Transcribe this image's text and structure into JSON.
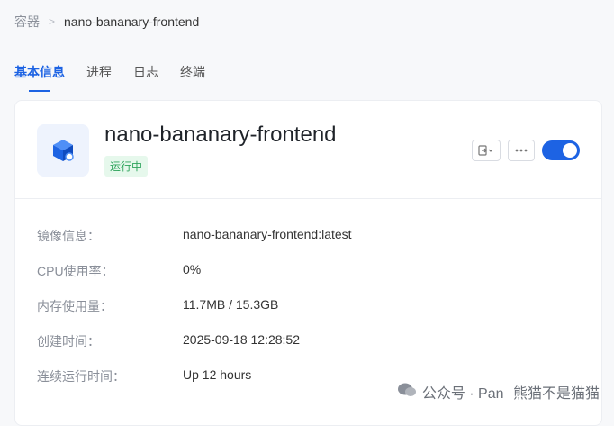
{
  "breadcrumb": {
    "root": "容器",
    "separator": ">",
    "current": "nano-bananary-frontend"
  },
  "tabs": [
    {
      "label": "基本信息",
      "active": true
    },
    {
      "label": "进程",
      "active": false
    },
    {
      "label": "日志",
      "active": false
    },
    {
      "label": "终端",
      "active": false
    }
  ],
  "container": {
    "name": "nano-bananary-frontend",
    "status": "运行中",
    "icon": "container-cube-icon",
    "running": true
  },
  "actions": {
    "login_icon": "login-icon",
    "more_icon": "more-icon"
  },
  "info": [
    {
      "label": "镜像信息：",
      "value": "nano-bananary-frontend:latest"
    },
    {
      "label": "CPU使用率：",
      "value": "0%"
    },
    {
      "label": "内存使用量：",
      "value": "11.7MB / 15.3GB"
    },
    {
      "label": "创建时间：",
      "value": "2025-09-18 12:28:52"
    },
    {
      "label": "连续运行时间：",
      "value": "Up 12 hours"
    }
  ],
  "watermark": {
    "text_left": "公众号 · Pan",
    "text_right": "熊猫不是猫猫"
  },
  "colors": {
    "accent": "#1d63e3",
    "status_bg": "#e6f8ec",
    "status_text": "#2ea35b"
  }
}
